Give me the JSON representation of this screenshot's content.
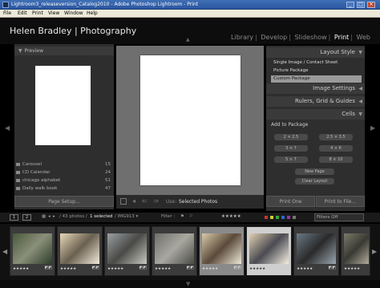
{
  "window": {
    "title": "Lightroom3_releaseversion_Catalog2010 - Adobe Photoshop Lightroom - Print",
    "minimize": "_",
    "maximize": "□",
    "close": "✕"
  },
  "menu": [
    "File",
    "Edit",
    "Print",
    "View",
    "Window",
    "Help"
  ],
  "header": {
    "identity_plate": "Helen Bradley | Photography",
    "modules": [
      "Library",
      "Develop",
      "Slideshow",
      "Print",
      "Web"
    ],
    "active_module": "Print"
  },
  "left_panel": {
    "preview_title": "Preview",
    "templates": [
      {
        "name": "Carousel",
        "count": "15"
      },
      {
        "name": "CD Calendar",
        "count": "24"
      },
      {
        "name": "chicago alphabet",
        "count": "51"
      },
      {
        "name": "Daily walk book",
        "count": "47"
      }
    ],
    "page_setup": "Page Setup..."
  },
  "center": {
    "use_label": "Use:",
    "use_value": "Selected Photos"
  },
  "right_panel": {
    "layout_style_title": "Layout Style",
    "styles": [
      "Single Image / Contact Sheet",
      "Picture Package",
      "Custom Package"
    ],
    "selected_style": "Custom Package",
    "sections": [
      "Image Settings",
      "Rulers, Grid & Guides",
      "Cells"
    ],
    "add_to_package": "Add to Package",
    "cell_sizes": [
      [
        "2 × 2.5",
        "2.5 × 3.5"
      ],
      [
        "3 × 7",
        "4 × 6"
      ],
      [
        "5 × 7",
        "8 × 10"
      ]
    ],
    "new_page": "New Page",
    "clear_layout": "Clear Layout",
    "print_one": "Print One",
    "print_file": "Print to File..."
  },
  "filmstrip_bar": {
    "view1": "1",
    "view2": "2",
    "count_text": "/ 43 photos /",
    "selected_text": "1 selected",
    "filename": "/ IMG913 ▾",
    "filter_label": "Filter :",
    "filters_off": "Filters Off",
    "label_colors": [
      "#c33",
      "#cc3",
      "#3a3",
      "#36c",
      "#939",
      "#777"
    ]
  },
  "filmstrip": {
    "thumbs": [
      {
        "stars": "★★★★★",
        "state": "normal",
        "colors": [
          "#4a5a3a",
          "#8a8f7a",
          "#2d3d2a"
        ]
      },
      {
        "stars": "★★★★★",
        "state": "normal",
        "colors": [
          "#e8d8b8",
          "#6a6050",
          "#f2eadc"
        ]
      },
      {
        "stars": "★★★★★",
        "state": "normal",
        "colors": [
          "#9aa0a0",
          "#4a4a48",
          "#c8c8c0"
        ]
      },
      {
        "stars": "★★★★★",
        "state": "normal",
        "colors": [
          "#6e6f6a",
          "#a8a8a0",
          "#4b4b46"
        ]
      },
      {
        "stars": "★★★★★",
        "state": "active",
        "colors": [
          "#d9c9a8",
          "#5a4a3a",
          "#eee8d8"
        ]
      },
      {
        "stars": "★★★★★",
        "state": "sel",
        "colors": [
          "#e0d0b0",
          "#4a4a52",
          "#f5efe0"
        ]
      },
      {
        "stars": "★★★★★",
        "state": "normal",
        "colors": [
          "#6a7a86",
          "#2a2a2a",
          "#9aa6b0"
        ]
      },
      {
        "stars": "★★★★★",
        "state": "normal",
        "colors": [
          "#7a7a6a",
          "#3a3a34",
          "#b0aa9a"
        ]
      }
    ]
  }
}
